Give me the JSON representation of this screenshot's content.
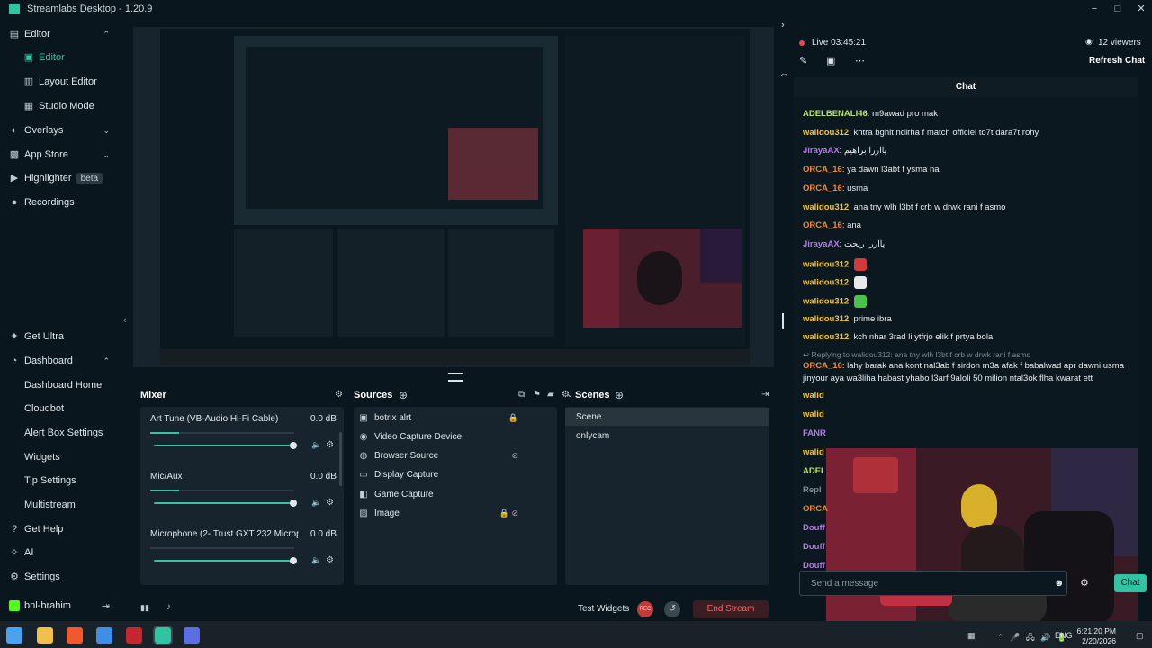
{
  "window": {
    "title": "Streamlabs Desktop - 1.20.9",
    "minimize": "−",
    "maximize": "□",
    "close": "✕"
  },
  "sidebar": {
    "items": [
      {
        "label": "Editor",
        "icon": "grid-icon",
        "glyph": "▤",
        "expandable": true,
        "chevron": "⌃"
      },
      {
        "label": "Editor",
        "icon": "editor-icon",
        "glyph": "▣",
        "sub": true,
        "active": true
      },
      {
        "label": "Layout Editor",
        "icon": "layout-icon",
        "glyph": "▥",
        "sub": true
      },
      {
        "label": "Studio Mode",
        "icon": "studio-icon",
        "glyph": "▦",
        "sub": true
      },
      {
        "label": "Overlays",
        "icon": "overlays-icon",
        "glyph": "◐",
        "chevron": "⌄"
      },
      {
        "label": "App Store",
        "icon": "store-icon",
        "glyph": "▩",
        "chevron": "⌄"
      },
      {
        "label": "Highlighter",
        "icon": "highlighter-icon",
        "glyph": "▶",
        "badge": "beta"
      },
      {
        "label": "Recordings",
        "icon": "recordings-icon",
        "glyph": "●"
      }
    ],
    "bottom_items": [
      {
        "label": "Get Ultra",
        "icon": "ultra-icon",
        "glyph": "✦"
      },
      {
        "label": "Dashboard",
        "icon": "dashboard-icon",
        "glyph": "◔",
        "chevron": "⌃"
      },
      {
        "label": "Dashboard Home",
        "sub": true
      },
      {
        "label": "Cloudbot",
        "sub": true
      },
      {
        "label": "Alert Box Settings",
        "sub": true
      },
      {
        "label": "Widgets",
        "sub": true
      },
      {
        "label": "Tip Settings",
        "sub": true
      },
      {
        "label": "Multistream",
        "sub": true
      },
      {
        "label": "Get Help",
        "icon": "help-icon",
        "glyph": "?"
      },
      {
        "label": "AI",
        "icon": "ai-icon",
        "glyph": "✧"
      },
      {
        "label": "Settings",
        "icon": "settings-icon",
        "glyph": "⚙"
      }
    ],
    "user": "bnl-brahim",
    "logout_glyph": "⇥",
    "collapse_glyph": "‹"
  },
  "mixer": {
    "title": "Mixer",
    "settings_glyph": "⚙",
    "channels": [
      {
        "name": "Art Tune (VB-Audio Hi-Fi Cable)",
        "db": "0.0 dB",
        "meter": 0.2,
        "volume": 0.97
      },
      {
        "name": "Mic/Aux",
        "db": "0.0 dB",
        "meter": 0.2,
        "volume": 0.97
      },
      {
        "name": "Microphone (2- Trust GXT 232 Microp...",
        "db": "0.0 dB",
        "meter": 0.0,
        "volume": 0.97
      }
    ],
    "mute_glyph": "🔈",
    "gear_glyph": "⚙"
  },
  "sources": {
    "title": "Sources",
    "add_glyph": "⊕",
    "items": [
      {
        "name": "botrix alrt",
        "glyph": "▣",
        "tail": "🔒"
      },
      {
        "name": "Video Capture Device",
        "glyph": "◉",
        "tail": ""
      },
      {
        "name": "Browser Source",
        "glyph": "◍",
        "tail": "⊘"
      },
      {
        "name": "Display Capture",
        "glyph": "▭",
        "tail": ""
      },
      {
        "name": "Game Capture",
        "glyph": "◧",
        "tail": ""
      },
      {
        "name": "Image",
        "glyph": "▨",
        "tail": "🔒 ⊘"
      }
    ]
  },
  "scenes": {
    "title": "Scenes",
    "add_glyph": "⊕",
    "collapse_glyph": "⇥",
    "items": [
      {
        "name": "Scene",
        "selected": true
      },
      {
        "name": "onlycam",
        "selected": false
      }
    ]
  },
  "footer": {
    "test_widgets": "Test Widgets",
    "rec_label": "REC",
    "replay_glyph": "↺",
    "end_stream": "End Stream",
    "stats_glyph": "▮▮",
    "bell_glyph": "♪"
  },
  "stream": {
    "live_label": "Live 03:45:21",
    "viewers": "12 viewers",
    "refresh_chat": "Refresh Chat",
    "chat_title": "Chat",
    "input_placeholder": "Send a message",
    "send_label": "Chat",
    "emoji_glyph": "☻",
    "settings_glyph": "⚙",
    "pencil_glyph": "✎",
    "popout_glyph": "▣",
    "share_glyph": "⋯",
    "eye_glyph": "◉",
    "expand_glyph": "›",
    "resize_glyph": "⇔"
  },
  "chat": [
    {
      "user": "ADELBENALI46",
      "color": "#b8e36b",
      "text": "m9awad pro mak"
    },
    {
      "user": "walidou312",
      "color": "#f0c435",
      "text": "khtra bghit ndirha f match officiel to7t dara7t rohy"
    },
    {
      "user": "JirayaAX",
      "color": "#b579e6",
      "text": "يااررا براهيم"
    },
    {
      "user": "ORCA_16",
      "color": "#f08a2b",
      "text": "ya dawn l3abt f ysma na"
    },
    {
      "user": "ORCA_16",
      "color": "#f08a2b",
      "text": "usma"
    },
    {
      "user": "walidou312",
      "color": "#f0c435",
      "text": "ana tny wlh l3bt f crb w drwk rani f asmo"
    },
    {
      "user": "ORCA_16",
      "color": "#f08a2b",
      "text": "ana"
    },
    {
      "user": "JirayaAX",
      "color": "#b579e6",
      "text": "يااررا ريحت"
    },
    {
      "user": "walidou312",
      "color": "#f0c435",
      "text": "",
      "emote": "#d23a3a"
    },
    {
      "user": "walidou312",
      "color": "#f0c435",
      "text": "",
      "emote": "#e8e8e8"
    },
    {
      "user": "walidou312",
      "color": "#f0c435",
      "text": "",
      "emote": "#49c44a"
    },
    {
      "user": "walidou312",
      "color": "#f0c435",
      "text": "prime ibra"
    },
    {
      "user": "walidou312",
      "color": "#f0c435",
      "text": "kch nhar 3rad li ytfrjo elik f prtya bola"
    }
  ],
  "reply": {
    "text": "↩ Replying to walidou312: ana tny wlh l3bt f crb w drwk rani f asmo",
    "user": "ORCA_16",
    "color": "#f08a2b",
    "line1": "lahy barak ana kont nal3ab f sirdon m3a afak f babalwad apr dawni usma",
    "line2": "jinyour aya wa3liha habast yhabo l3arf 9aloli 50 milion ntal3ok flha kwarat ett"
  },
  "chat_partial": [
    {
      "user": "walid",
      "color": "#f0c435"
    },
    {
      "user": "walid",
      "color": "#f0c435"
    },
    {
      "user": "FANR",
      "color": "#b579e6"
    },
    {
      "user": "walid",
      "color": "#f0c435"
    },
    {
      "user": "ADEL",
      "color": "#b8e36b"
    },
    {
      "user": "Repl",
      "color": "#7a8a92"
    },
    {
      "user": "ORCA",
      "color": "#f08a2b"
    },
    {
      "user": "Douff",
      "color": "#b579e6"
    },
    {
      "user": "Douff",
      "color": "#b579e6"
    },
    {
      "user": "Douff",
      "color": "#b579e6"
    }
  ],
  "taskbar": {
    "apps": [
      {
        "icon": "windows-start-icon",
        "color": "#4aa3f0"
      },
      {
        "icon": "file-explorer-icon",
        "color": "#f1c04a"
      },
      {
        "icon": "brave-browser-icon",
        "color": "#f1582b"
      },
      {
        "icon": "microsoft-store-icon",
        "color": "#3d8fe8"
      },
      {
        "icon": "app-red-icon",
        "color": "#c6262e"
      },
      {
        "icon": "streamlabs-icon",
        "color": "#31c3a2"
      },
      {
        "icon": "app-blue-icon",
        "color": "#5b6fe0"
      }
    ],
    "lang": "ENG",
    "time": "6:21:20 PM",
    "date": "2/20/2026",
    "tray_glyphs": "⌃  🎤  🖧  🔊  🔋"
  }
}
